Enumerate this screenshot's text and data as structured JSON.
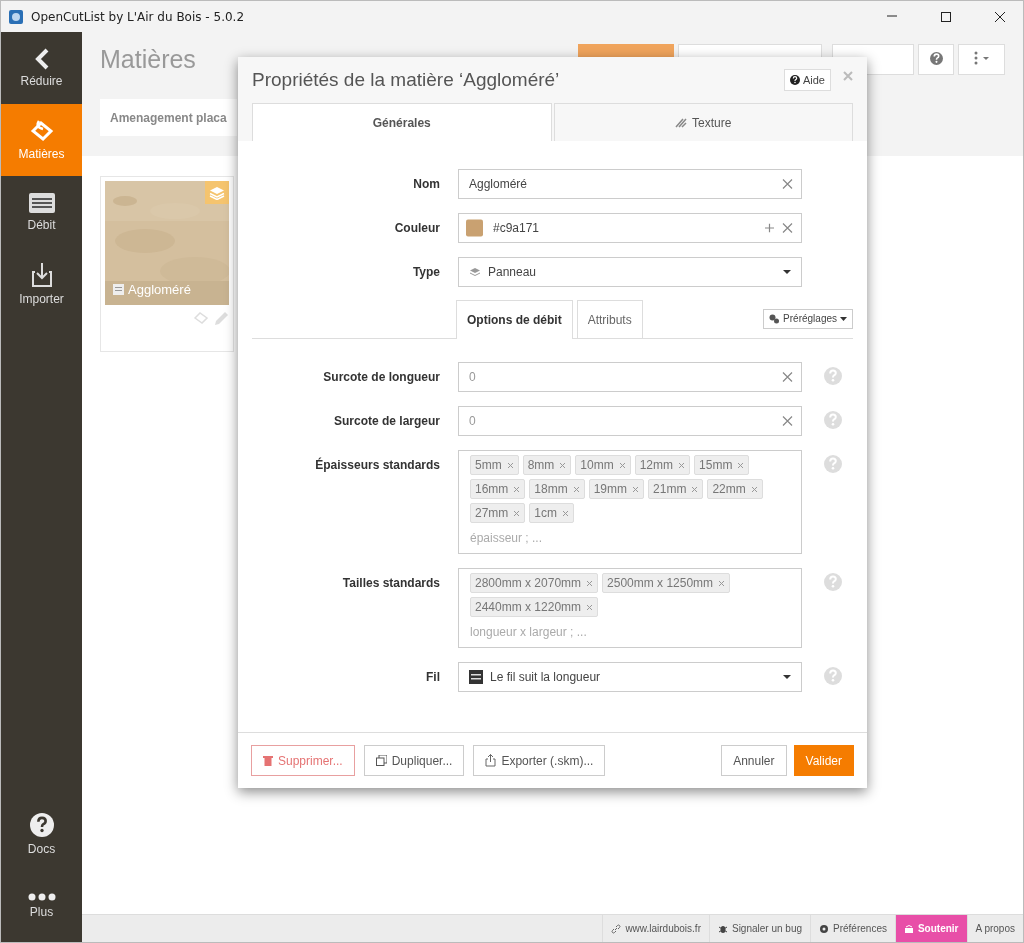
{
  "window": {
    "title": "OpenCutList by L'Air du Bois - 5.0.2"
  },
  "sidebar": {
    "items": [
      {
        "kind": "back",
        "label": "Réduire",
        "selected": false
      },
      {
        "kind": "materials",
        "label": "Matières",
        "selected": true
      },
      {
        "kind": "cutlist",
        "label": "Débit",
        "selected": false
      },
      {
        "kind": "import",
        "label": "Importer",
        "selected": false
      }
    ],
    "bottom_items": [
      {
        "kind": "docs",
        "label": "Docs",
        "selected": false
      },
      {
        "kind": "more",
        "label": "Plus",
        "selected": false
      }
    ]
  },
  "page": {
    "title": "Matières",
    "tabs": [
      {
        "label": "Amenagement placa",
        "selected": true
      }
    ],
    "materials": [
      {
        "name": "Aggloméré"
      }
    ]
  },
  "dialog": {
    "title": "Propriétés de la matière ‘Aggloméré’",
    "help_button": "Aide",
    "tabs": [
      {
        "kind": "general",
        "label": "Générales",
        "selected": true
      },
      {
        "kind": "texture",
        "label": "Texture",
        "selected": false
      }
    ],
    "fields": [
      {
        "kind": "text",
        "label": "Nom",
        "value": "Aggloméré"
      },
      {
        "kind": "color",
        "label": "Couleur",
        "value": "#c9a171",
        "color": "#c9a171"
      },
      {
        "kind": "select",
        "label": "Type",
        "value": "Panneau"
      }
    ],
    "subtabs": [
      {
        "label": "Options de débit",
        "selected": true
      },
      {
        "label": "Attributs",
        "selected": false
      }
    ],
    "presets_button": "Préréglages",
    "options": [
      {
        "kind": "text",
        "label": "Surcote de longueur",
        "placeholder": "0"
      },
      {
        "kind": "text",
        "label": "Surcote de largeur",
        "placeholder": "0"
      },
      {
        "kind": "tags",
        "label": "Épaisseurs standards",
        "tags": [
          "5mm",
          "8mm",
          "10mm",
          "12mm",
          "15mm",
          "16mm",
          "18mm",
          "19mm",
          "21mm",
          "22mm",
          "27mm",
          "1cm"
        ],
        "placeholder": "épaisseur ; ..."
      },
      {
        "kind": "tags",
        "label": "Tailles standards",
        "tags": [
          "2800mm x 2070mm",
          "2500mm x 1250mm",
          "2440mm x 1220mm"
        ],
        "placeholder": "longueur x largeur ; ..."
      },
      {
        "kind": "select",
        "label": "Fil",
        "value": "Le fil suit la longueur"
      }
    ],
    "buttons": [
      {
        "kind": "danger",
        "label": "Supprimer..."
      },
      {
        "kind": "duplicate",
        "label": "Dupliquer..."
      },
      {
        "kind": "export",
        "label": "Exporter (.skm)..."
      },
      {
        "kind": "cancel",
        "label": "Annuler"
      },
      {
        "kind": "primary",
        "label": "Valider"
      }
    ]
  },
  "status_bar": {
    "items": [
      {
        "kind": "link",
        "label": "www.lairdubois.fr"
      },
      {
        "kind": "bug",
        "label": "Signaler un bug"
      },
      {
        "kind": "prefs",
        "label": "Préférences"
      },
      {
        "kind": "support",
        "label": "Soutenir"
      },
      {
        "kind": "plain",
        "label": "A propos"
      }
    ]
  }
}
